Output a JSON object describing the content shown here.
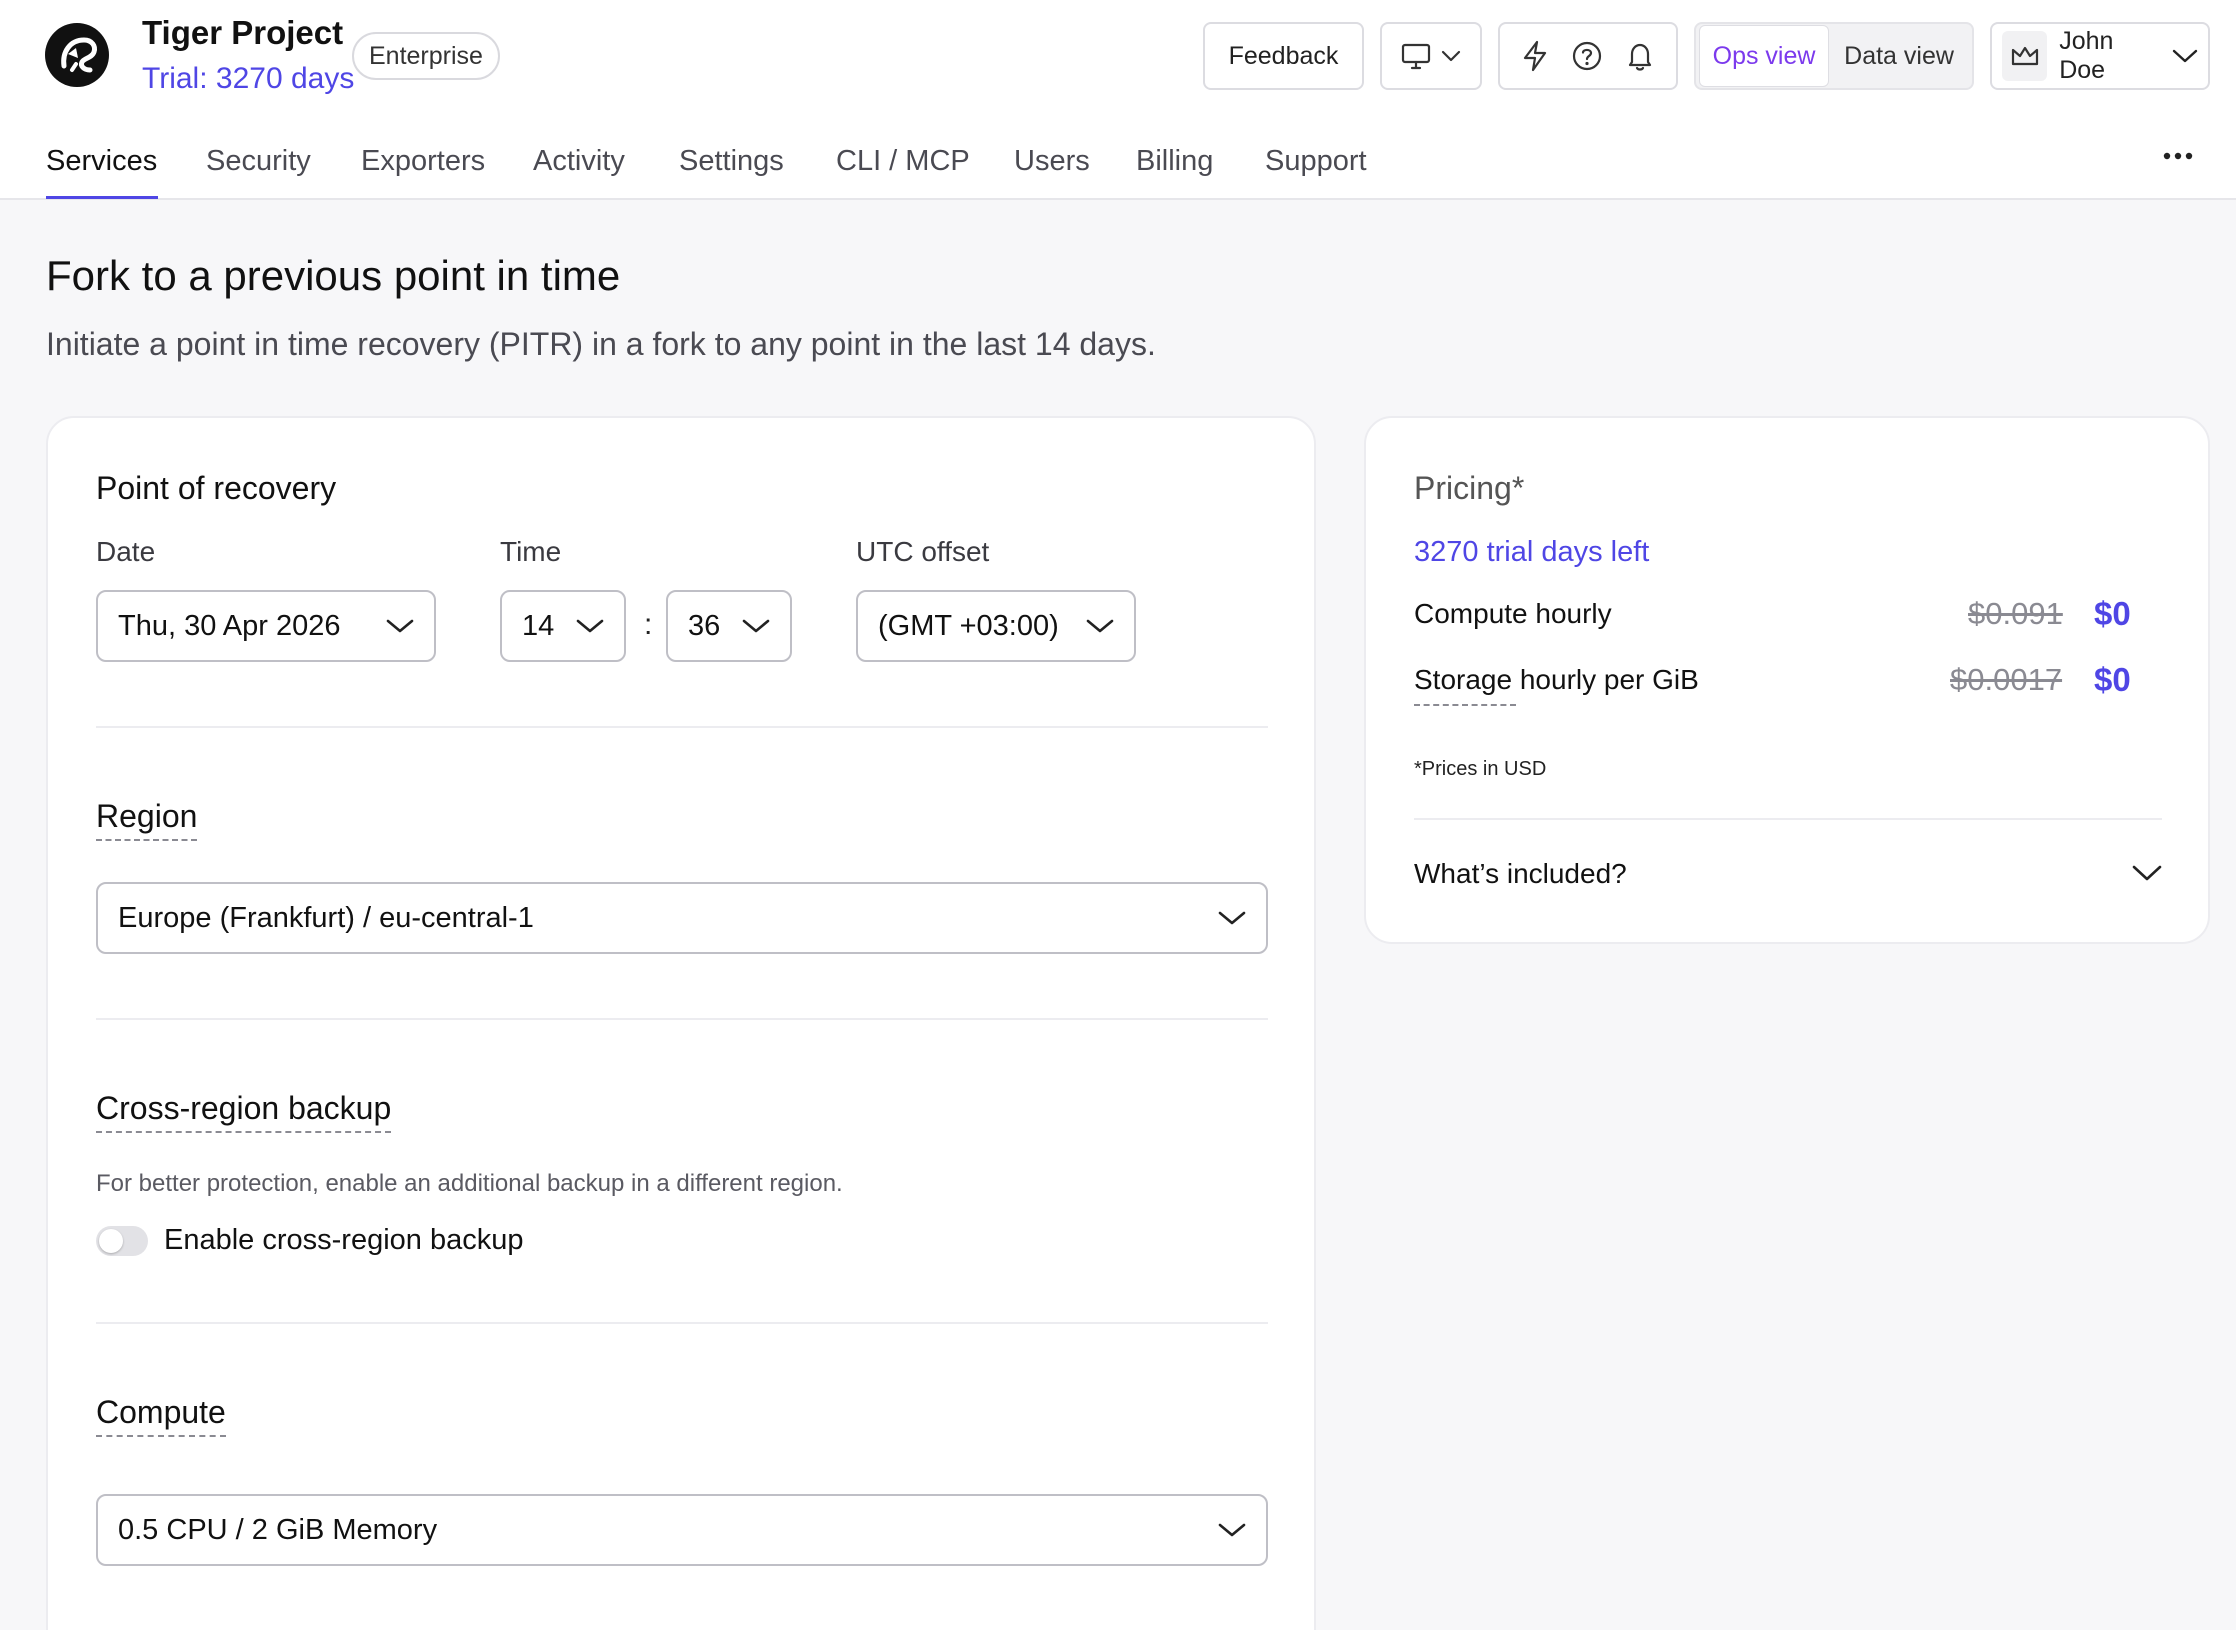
{
  "header": {
    "project_name": "Tiger Project",
    "trial_text": "Trial: 3270 days",
    "plan_badge": "Enterprise",
    "feedback_label": "Feedback",
    "view_toggle": {
      "ops": "Ops view",
      "data": "Data view",
      "active": "ops"
    },
    "user_name": "John Doe"
  },
  "tabs": [
    {
      "label": "Services",
      "active": true
    },
    {
      "label": "Security"
    },
    {
      "label": "Exporters"
    },
    {
      "label": "Activity"
    },
    {
      "label": "Settings"
    },
    {
      "label": "CLI / MCP"
    },
    {
      "label": "Users"
    },
    {
      "label": "Billing"
    },
    {
      "label": "Support"
    }
  ],
  "page": {
    "title": "Fork to a previous point in time",
    "subtitle": "Initiate a point in time recovery (PITR) in a fork to any point in the last 14 days."
  },
  "recovery": {
    "title": "Point of recovery",
    "date_label": "Date",
    "date_value": "Thu, 30 Apr 2026",
    "time_label": "Time",
    "hour_value": "14",
    "minute_value": "36",
    "separator": ":",
    "utc_label": "UTC offset",
    "utc_value": "(GMT +03:00)"
  },
  "region": {
    "title": "Region",
    "value": "Europe (Frankfurt) / eu-central-1"
  },
  "backup": {
    "title": "Cross-region backup",
    "help": "For better protection, enable an additional backup in a different region.",
    "toggle_label": "Enable cross-region backup",
    "enabled": false
  },
  "compute": {
    "title": "Compute",
    "value": "0.5 CPU / 2 GiB Memory"
  },
  "pricing": {
    "title": "Pricing*",
    "trial_days": "3270 trial days left",
    "rows": [
      {
        "label": "Compute hourly",
        "old": "$0.091",
        "new": "$0"
      },
      {
        "label": "Storage hourly per GiB",
        "old": "$0.0017",
        "new": "$0"
      }
    ],
    "note": "*Prices in USD",
    "included_label": "What’s included?"
  },
  "colors": {
    "accent": "#4f46e5",
    "ops_view": "#7c3aed",
    "tab_active_underline": "#4f46e5"
  }
}
